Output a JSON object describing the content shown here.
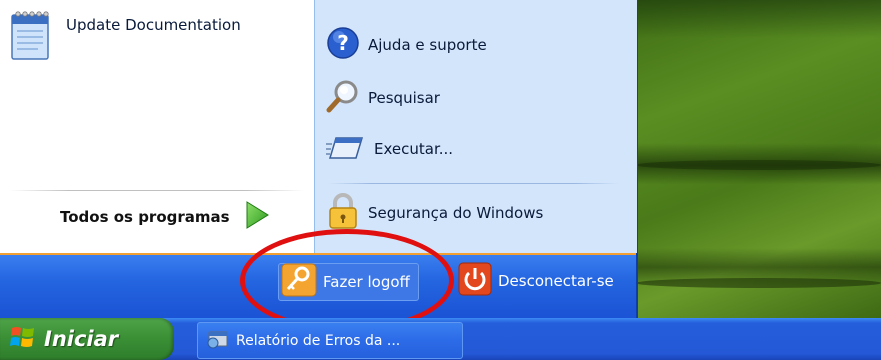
{
  "start_menu": {
    "pinned": [
      {
        "label": "Update Documentation",
        "icon": "notepad-icon"
      }
    ],
    "all_programs_label": "Todos os programas",
    "right_items": [
      {
        "label": "Ajuda e suporte",
        "icon": "help-icon"
      },
      {
        "label": "Pesquisar",
        "icon": "search-icon"
      },
      {
        "label": "Executar...",
        "icon": "run-icon"
      },
      {
        "label": "Segurança do Windows",
        "icon": "lock-icon"
      }
    ],
    "bottom": {
      "logoff_label": "Fazer logoff",
      "disconnect_label": "Desconectar-se"
    }
  },
  "taskbar": {
    "start_label": "Iniciar",
    "tasks": [
      {
        "label": "Relatório de Erros da ..."
      }
    ]
  },
  "colors": {
    "menu_blue": "#1d59d9",
    "right_pane": "#d3e5fa",
    "highlight_ellipse": "#e01010",
    "start_green": "#3a8f35"
  }
}
